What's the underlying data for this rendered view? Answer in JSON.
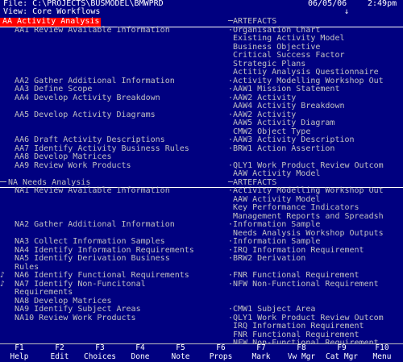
{
  "title": {
    "file": "File: C:\\PROJECTS\\BUSMODEL\\BMWPRD",
    "view": "View: Core Workflows",
    "date": "06/05/06",
    "time": "2:49pm"
  },
  "sections": [
    {
      "header": "AA Activity Analysis",
      "artefacts_header": "ARTEFACTS",
      "rows": [
        {
          "left": "   AA1 Review Available Information",
          "right": "·Organisation Chart"
        },
        {
          "left": "",
          "right": " Existing Activity Model"
        },
        {
          "left": "",
          "right": " Business Objective"
        },
        {
          "left": "",
          "right": " Critical Success Factor"
        },
        {
          "left": "",
          "right": " Strategic Plans"
        },
        {
          "left": "",
          "right": " Actitiy Analysis Questionnaire"
        },
        {
          "left": "   AA2 Gather Additional Information",
          "right": "·Activity Modelling Workshop Out"
        },
        {
          "left": "   AA3 Define Scope",
          "right": "·AAW1 Mission Statement"
        },
        {
          "left": "   AA4 Develop Activity Breakdown",
          "right": "·AAW2 Activity"
        },
        {
          "left": "",
          "right": " AAW4 Activity Breakdown"
        },
        {
          "left": "   AA5 Develop Activity Diagrams",
          "right": "·AAW2 Activity"
        },
        {
          "left": "",
          "right": " AAW5 Activity Diagram"
        },
        {
          "left": "",
          "right": " CMW2 Object Type"
        },
        {
          "left": "   AA6 Draft Activity Descriptions",
          "right": "·AAW3 Activity Description"
        },
        {
          "left": "   AA7 Identify Activity Business Rules",
          "right": "·BRW1 Action Assertion"
        },
        {
          "left": "   AA8 Develop Matrices",
          "right": ""
        },
        {
          "left": "   AA9 Review Work Products",
          "right": "·QLY1 Work Product Review Outcom"
        },
        {
          "left": "",
          "right": " AAW Activity Model"
        }
      ]
    },
    {
      "header": "NA Needs Analysis",
      "artefacts_header": "ARTEFACTS",
      "rows": [
        {
          "left": "   NA1 Review Available Information",
          "right": "·Activity Modelling Workshop Out"
        },
        {
          "left": "",
          "right": " AAW Activity Model"
        },
        {
          "left": "",
          "right": " Key Performance Indicators"
        },
        {
          "left": "",
          "right": " Management Reports and Spreadsh"
        },
        {
          "left": "   NA2 Gather Additional Information",
          "right": "·Information Sample"
        },
        {
          "left": "",
          "right": " Needs Analysis Workshop Outputs"
        },
        {
          "left": "   NA3 Collect Information Samples",
          "right": "·Information Sample"
        },
        {
          "left": "   NA4 Identify Information Requirements",
          "right": "·IRQ Information Requirement"
        },
        {
          "left": "   NA5 Identify Derivation Business",
          "right": "·BRW2 Derivation"
        },
        {
          "left": "   Rules",
          "right": ""
        },
        {
          "left": "♪  NA6 Identify Functional Requirements",
          "right": "·FNR Functional Requirement"
        },
        {
          "left": "♪  NA7 Identify Non-Funcitonal",
          "right": "·NFW Non-Functional Requirement"
        },
        {
          "left": "   Requirements",
          "right": ""
        },
        {
          "left": "   NA8 Develop Matrices",
          "right": ""
        },
        {
          "left": "   NA9 Identify Subject Areas",
          "right": "·CMW1 Subject Area"
        },
        {
          "left": "   NA10 Review Work Products",
          "right": "·QLY1 Work Product Review Outcom"
        },
        {
          "left": "",
          "right": " IRQ Information Requirement"
        },
        {
          "left": "",
          "right": " FNR Functional Requirement"
        },
        {
          "left": "",
          "right": " NFW Non-Functional Requirement"
        }
      ]
    }
  ],
  "fkeys": [
    {
      "key": "F1",
      "label": "Help"
    },
    {
      "key": "F2",
      "label": "Edit"
    },
    {
      "key": "F3",
      "label": "Choices"
    },
    {
      "key": "F4",
      "label": "Done"
    },
    {
      "key": "F5",
      "label": "Note"
    },
    {
      "key": "F6",
      "label": "Props"
    },
    {
      "key": "F7",
      "label": "Mark"
    },
    {
      "key": "F8",
      "label": "Vw Mgr"
    },
    {
      "key": "F9",
      "label": "Cat Mgr"
    },
    {
      "key": "F10",
      "label": "Menu"
    }
  ],
  "colors": {
    "background": "#000080",
    "selected_header": "#ff0000",
    "text": "#c0c0c0"
  }
}
